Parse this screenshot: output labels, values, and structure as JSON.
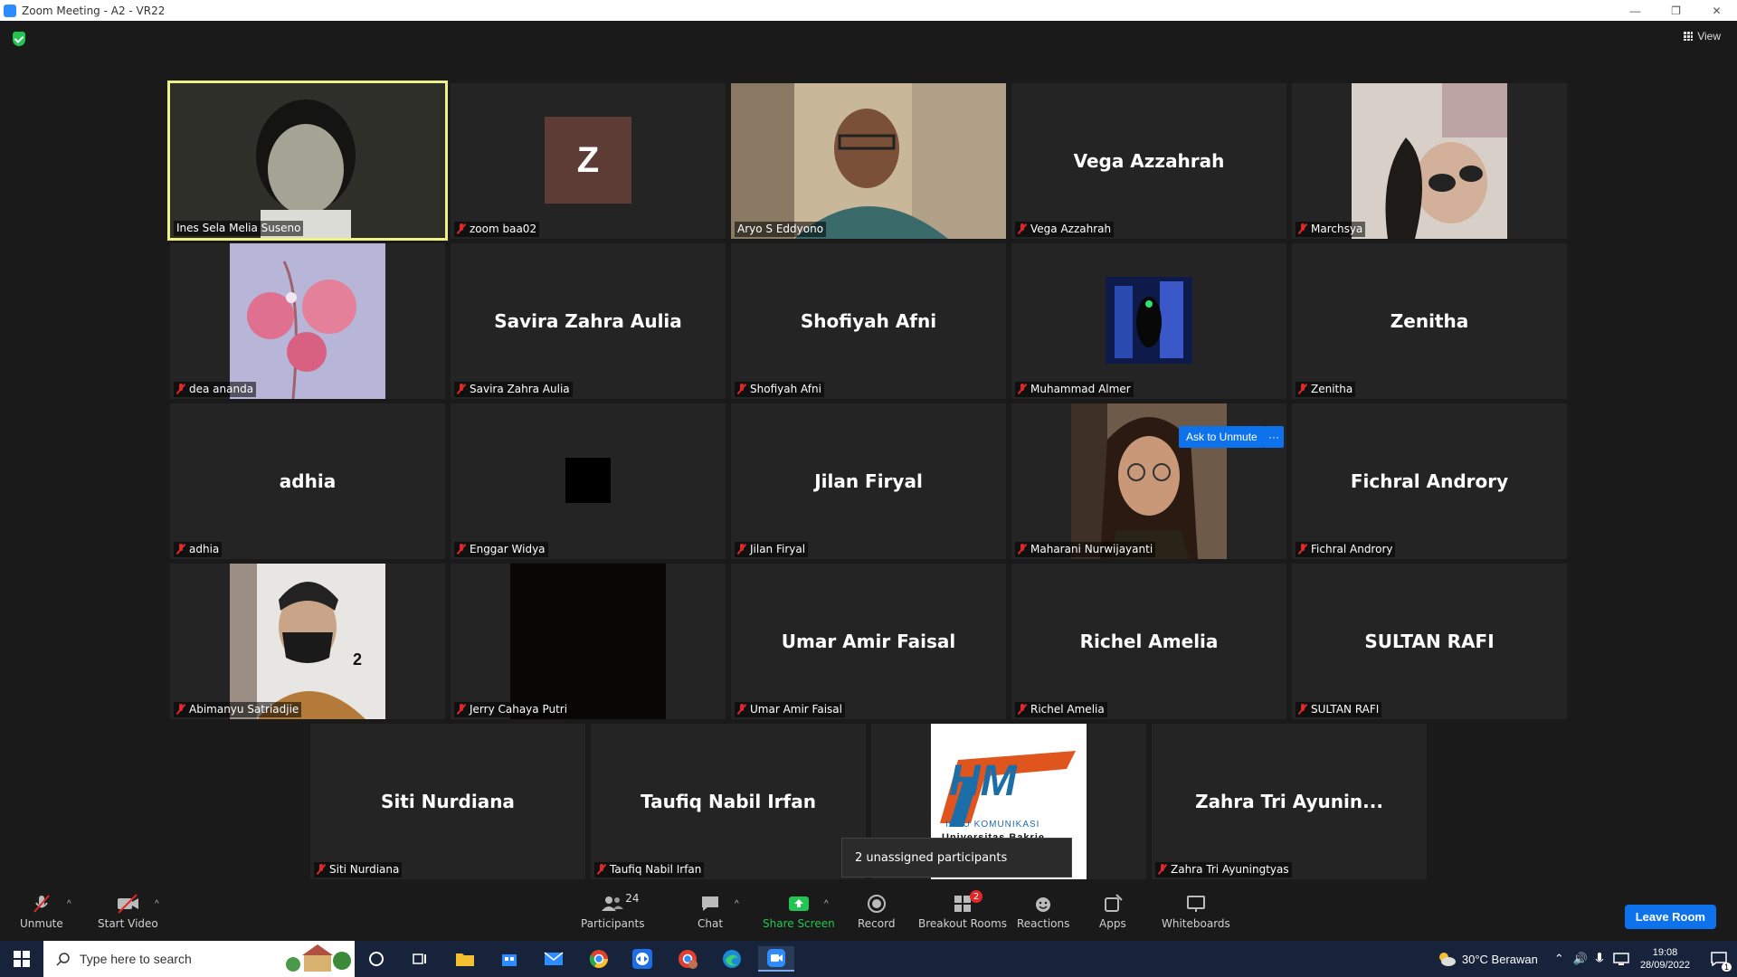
{
  "window": {
    "title": "Zoom Meeting - A2 - VR22",
    "minimize": "—",
    "restore": "❐",
    "close": "✕"
  },
  "view_label": "View",
  "tiles": [
    {
      "name": "Ines Sela Melia Suseno",
      "display": ""
    },
    {
      "name": "zoom baa02",
      "display": "",
      "avatar_letter": "Z"
    },
    {
      "name": "Aryo S Eddyono",
      "display": ""
    },
    {
      "name": "Vega Azzahrah",
      "display": "Vega Azzahrah"
    },
    {
      "name": "Marchsya",
      "display": ""
    },
    {
      "name": "dea ananda",
      "display": ""
    },
    {
      "name": "Savira Zahra Aulia",
      "display": "Savira Zahra Aulia"
    },
    {
      "name": "Shofiyah Afni",
      "display": "Shofiyah Afni"
    },
    {
      "name": "Muhammad Almer",
      "display": ""
    },
    {
      "name": "Zenitha",
      "display": "Zenitha"
    },
    {
      "name": "adhia",
      "display": "adhia"
    },
    {
      "name": "Enggar Widya",
      "display": ""
    },
    {
      "name": "Jilan Firyal",
      "display": "Jilan Firyal"
    },
    {
      "name": "Maharani Nurwijayanti",
      "display": ""
    },
    {
      "name": "Fichral Androry",
      "display": "Fichral Androry"
    },
    {
      "name": "Abimanyu Satriadjie",
      "display": ""
    },
    {
      "name": "Jerry Cahaya Putri",
      "display": ""
    },
    {
      "name": "Umar Amir Faisal",
      "display": "Umar Amir Faisal"
    },
    {
      "name": "Richel Amelia",
      "display": "Richel Amelia"
    },
    {
      "name": "SULTAN RAFI",
      "display": "SULTAN RAFI"
    },
    {
      "name": "Siti Nurdiana",
      "display": "Siti Nurdiana"
    },
    {
      "name": "Taufiq Nabil Irfan",
      "display": "Taufiq Nabil Irfan"
    },
    {
      "name": "",
      "display": ""
    },
    {
      "name": "Zahra Tri Ayuningtyas",
      "display": "Zahra Tri Ayunin..."
    }
  ],
  "ask_to_unmute": "Ask to Unmute",
  "more_dots": "···",
  "abimanyu_number": "2",
  "logo_text": {
    "hm": "HM",
    "line1": "ILMU KOMUNIKASI",
    "line2": "Universitas Bakrie"
  },
  "unassigned_tooltip": "2 unassigned participants",
  "toolbar": {
    "unmute": "Unmute",
    "start_video": "Start Video",
    "participants": "Participants",
    "participants_count": "24",
    "chat": "Chat",
    "share_screen": "Share Screen",
    "record": "Record",
    "breakout_rooms": "Breakout Rooms",
    "breakout_badge": "2",
    "reactions": "Reactions",
    "apps": "Apps",
    "whiteboards": "Whiteboards",
    "leave_room": "Leave Room",
    "caret": "^"
  },
  "taskbar": {
    "search_placeholder": "Type here to search",
    "weather": "30°C  Berawan",
    "time": "19:08",
    "date": "28/09/2022",
    "notification_count": "1"
  },
  "colors": {
    "accent": "#0e72ed",
    "share_green": "#23c552",
    "muted_red": "#e02828",
    "active_border": "#f0f08a"
  }
}
